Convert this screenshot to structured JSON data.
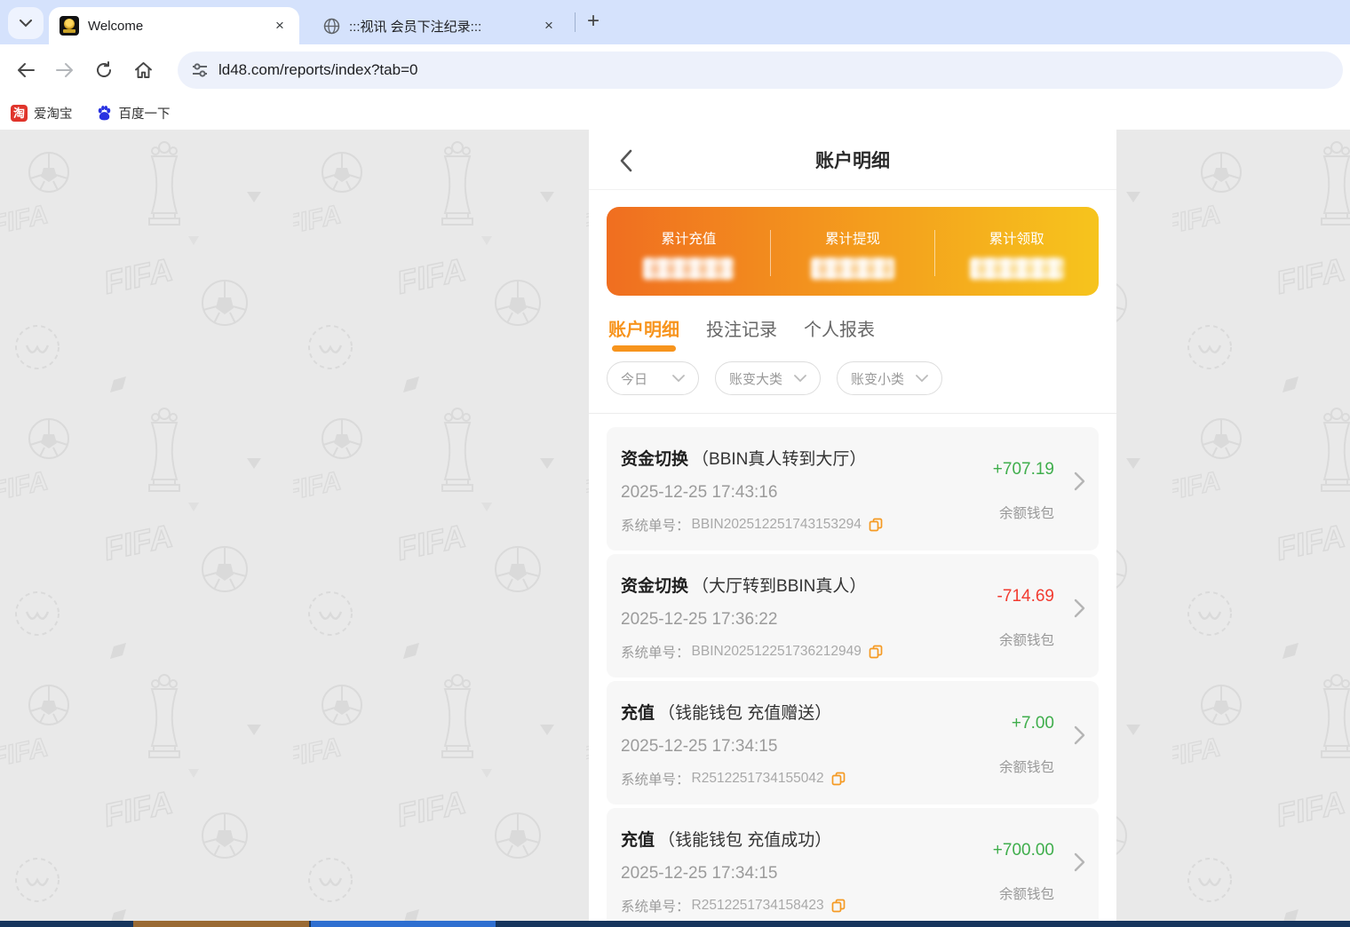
{
  "browser": {
    "tab_search_icon": "chevron-down",
    "tabs": [
      {
        "title": "Welcome"
      },
      {
        "title": ":::视讯 会员下注纪录:::"
      }
    ],
    "close_label": "×",
    "new_tab_label": "+",
    "url": "ld48.com/reports/index?tab=0",
    "bookmarks": [
      {
        "label": "爱淘宝",
        "icon_letter": "淘"
      },
      {
        "label": "百度一下"
      }
    ]
  },
  "page": {
    "header": {
      "title": "账户明细"
    },
    "stats": [
      {
        "label": "累计充值",
        "value_hidden": true
      },
      {
        "label": "累计提现",
        "value_hidden": true
      },
      {
        "label": "累计领取",
        "value_hidden": true
      }
    ],
    "nav_tabs": [
      {
        "label": "账户明细",
        "active": true
      },
      {
        "label": "投注记录",
        "active": false
      },
      {
        "label": "个人报表",
        "active": false
      }
    ],
    "filters": [
      {
        "label": "今日"
      },
      {
        "label": "账变大类"
      },
      {
        "label": "账变小类"
      }
    ],
    "order_label": "系统单号：",
    "records": [
      {
        "type": "资金切换",
        "subtitle": "（BBIN真人转到大厅）",
        "datetime": "2025-12-25 17:43:16",
        "order_no": "BBIN202512251743153294",
        "amount": "+707.19",
        "amount_style": "color:#3fae4c",
        "wallet": "余额钱包"
      },
      {
        "type": "资金切换",
        "subtitle": "（大厅转到BBIN真人）",
        "datetime": "2025-12-25 17:36:22",
        "order_no": "BBIN202512251736212949",
        "amount": "-714.69",
        "amount_style": "color:#f23b30",
        "wallet": "余额钱包"
      },
      {
        "type": "充值",
        "subtitle": "（钱能钱包 充值赠送）",
        "datetime": "2025-12-25 17:34:15",
        "order_no": "R2512251734155042",
        "amount": "+7.00",
        "amount_style": "color:#3fae4c",
        "wallet": "余额钱包"
      },
      {
        "type": "充值",
        "subtitle": "（钱能钱包 充值成功）",
        "datetime": "2025-12-25 17:34:15",
        "order_no": "R2512251734158423",
        "amount": "+700.00",
        "amount_style": "color:#3fae4c",
        "wallet": "余额钱包"
      }
    ],
    "colors": {
      "accent_orange": "#f7941d",
      "positive_green": "#3fae4c",
      "negative_red": "#f23b30",
      "card_gradient_start": "#f06e20",
      "card_gradient_end": "#f6c41d"
    }
  }
}
